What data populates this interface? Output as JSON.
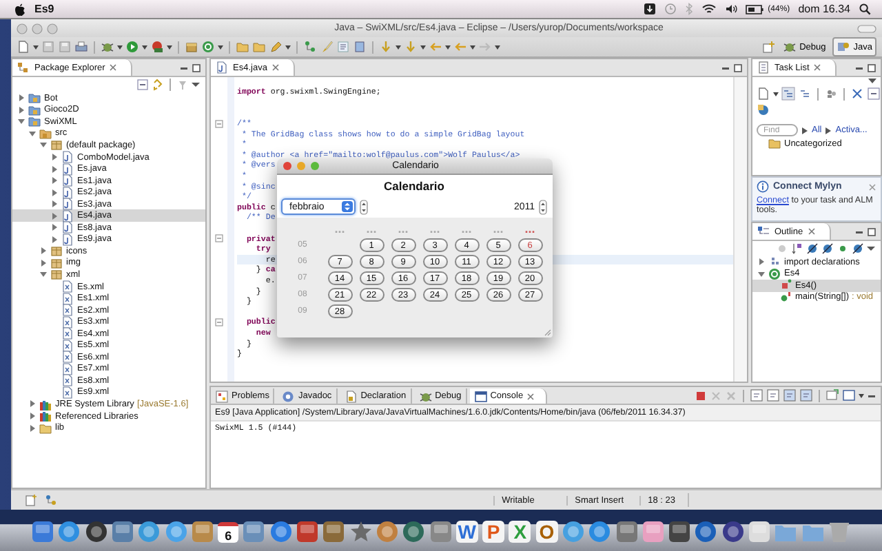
{
  "menubar": {
    "app": "Es9",
    "battery": "(44%)",
    "clock": "dom 16.34"
  },
  "window": {
    "title": "Java – SwiXML/src/Es4.java – Eclipse – /Users/yurop/Documents/workspace"
  },
  "perspectives": [
    {
      "label": "Debug",
      "selected": false
    },
    {
      "label": "Java",
      "selected": true
    }
  ],
  "package_explorer": {
    "title": "Package Explorer",
    "tree": [
      {
        "label": "Bot",
        "kind": "project",
        "expanded": false,
        "selected": false
      },
      {
        "label": "Gioco2D",
        "kind": "project",
        "expanded": false,
        "selected": false
      },
      {
        "label": "SwiXML",
        "kind": "project",
        "expanded": true,
        "selected": false,
        "children": [
          {
            "label": "src",
            "kind": "source",
            "expanded": true,
            "selected": false,
            "children": [
              {
                "label": "(default package)",
                "kind": "package",
                "expanded": true,
                "selected": false,
                "children": [
                  {
                    "label": "ComboModel.java",
                    "kind": "java",
                    "expanded": false,
                    "selected": false
                  },
                  {
                    "label": "Es.java",
                    "kind": "java",
                    "expanded": false,
                    "selected": false
                  },
                  {
                    "label": "Es1.java",
                    "kind": "java",
                    "expanded": false,
                    "selected": false
                  },
                  {
                    "label": "Es2.java",
                    "kind": "java",
                    "expanded": false,
                    "selected": false
                  },
                  {
                    "label": "Es3.java",
                    "kind": "java",
                    "expanded": false,
                    "selected": false
                  },
                  {
                    "label": "Es4.java",
                    "kind": "java",
                    "expanded": false,
                    "selected": true
                  },
                  {
                    "label": "Es8.java",
                    "kind": "java",
                    "expanded": false,
                    "selected": false
                  },
                  {
                    "label": "Es9.java",
                    "kind": "java",
                    "expanded": false,
                    "selected": false
                  }
                ]
              },
              {
                "label": "icons",
                "kind": "package",
                "expanded": false,
                "selected": false
              },
              {
                "label": "img",
                "kind": "package",
                "expanded": false,
                "selected": false
              },
              {
                "label": "xml",
                "kind": "package",
                "expanded": true,
                "selected": false,
                "children": [
                  {
                    "label": "Es.xml",
                    "kind": "xml",
                    "selected": false
                  },
                  {
                    "label": "Es1.xml",
                    "kind": "xml",
                    "selected": false
                  },
                  {
                    "label": "Es2.xml",
                    "kind": "xml",
                    "selected": false
                  },
                  {
                    "label": "Es3.xml",
                    "kind": "xml",
                    "selected": false
                  },
                  {
                    "label": "Es4.xml",
                    "kind": "xml",
                    "selected": false
                  },
                  {
                    "label": "Es5.xml",
                    "kind": "xml",
                    "selected": false
                  },
                  {
                    "label": "Es6.xml",
                    "kind": "xml",
                    "selected": false
                  },
                  {
                    "label": "Es7.xml",
                    "kind": "xml",
                    "selected": false
                  },
                  {
                    "label": "Es8.xml",
                    "kind": "xml",
                    "selected": false
                  },
                  {
                    "label": "Es9.xml",
                    "kind": "xml",
                    "selected": false
                  }
                ]
              }
            ]
          },
          {
            "label": "JRE System Library",
            "decoration": "[JavaSE-1.6]",
            "kind": "library",
            "expanded": false,
            "selected": false
          },
          {
            "label": "Referenced Libraries",
            "kind": "library",
            "expanded": false,
            "selected": false
          },
          {
            "label": "lib",
            "kind": "folder",
            "expanded": false,
            "selected": false
          }
        ]
      }
    ]
  },
  "editor": {
    "tab": "Es4.java",
    "lines": [
      {
        "segments": [
          {
            "text": "import",
            "kind": "keyword"
          },
          {
            "text": " org.swixml.SwingEngine;",
            "kind": "plain"
          }
        ]
      },
      {
        "kind": "blank"
      },
      {
        "kind": "blank"
      },
      {
        "fold": true,
        "segments": [
          {
            "text": "/**",
            "kind": "comment"
          }
        ]
      },
      {
        "segments": [
          {
            "text": " * The GridBag class shows how to do a simple GridBag layout",
            "kind": "comment"
          }
        ]
      },
      {
        "segments": [
          {
            "text": " *",
            "kind": "comment"
          }
        ]
      },
      {
        "segments": [
          {
            "text": " * @author <a href=\"mailto:wolf@paulus.com\">Wolf Paulus</a>",
            "kind": "comment"
          }
        ]
      },
      {
        "segments": [
          {
            "text": " * @vers",
            "kind": "comment"
          }
        ]
      },
      {
        "segments": [
          {
            "text": " *",
            "kind": "comment"
          }
        ]
      },
      {
        "segments": [
          {
            "text": " * @sinc",
            "kind": "comment"
          }
        ]
      },
      {
        "segments": [
          {
            "text": " */",
            "kind": "comment"
          }
        ]
      },
      {
        "segments": [
          {
            "text": "public",
            "kind": "keyword"
          },
          {
            "text": " c",
            "kind": "plain"
          }
        ]
      },
      {
        "segments": [
          {
            "text": "  /** De",
            "kind": "comment"
          }
        ]
      },
      {
        "kind": "blank"
      },
      {
        "fold": true,
        "segments": [
          {
            "text": "  privat",
            "kind": "keyword"
          }
        ]
      },
      {
        "segments": [
          {
            "text": "    try",
            "kind": "keyword"
          }
        ]
      },
      {
        "highlighted": true,
        "segments": [
          {
            "text": "      re",
            "kind": "plain"
          }
        ]
      },
      {
        "segments": [
          {
            "text": "    } ",
            "kind": "plain"
          },
          {
            "text": "ca",
            "kind": "keyword"
          }
        ]
      },
      {
        "segments": [
          {
            "text": "      e.",
            "kind": "plain"
          }
        ]
      },
      {
        "segments": [
          {
            "text": "    }",
            "kind": "plain"
          }
        ]
      },
      {
        "segments": [
          {
            "text": "  }",
            "kind": "plain"
          }
        ]
      },
      {
        "kind": "blank"
      },
      {
        "fold": true,
        "segments": [
          {
            "text": "  public",
            "kind": "keyword"
          }
        ]
      },
      {
        "segments": [
          {
            "text": "    new",
            "kind": "keyword"
          }
        ]
      },
      {
        "segments": [
          {
            "text": "  }",
            "kind": "plain"
          }
        ]
      },
      {
        "segments": [
          {
            "text": "}",
            "kind": "plain"
          }
        ]
      }
    ]
  },
  "dialog": {
    "title": "Calendario",
    "heading": "Calendario",
    "month": "febbraio",
    "year": "2011",
    "weekdays": [
      {
        "text": "...",
        "color": "#a8a8a8"
      },
      {
        "text": "...",
        "color": "#a8a8a8"
      },
      {
        "text": "...",
        "color": "#a8a8a8"
      },
      {
        "text": "...",
        "color": "#a8a8a8"
      },
      {
        "text": "...",
        "color": "#a8a8a8"
      },
      {
        "text": "...",
        "color": "#a8a8a8"
      },
      {
        "text": "...",
        "color": "#d05a5a"
      }
    ],
    "weeks": [
      {
        "number": "05",
        "days": [
          {
            "label": "1",
            "today": false
          },
          {
            "label": "2",
            "today": false
          },
          {
            "label": "3",
            "today": false
          },
          {
            "label": "4",
            "today": false
          },
          {
            "label": "5",
            "today": false
          },
          {
            "label": "6",
            "today": true
          }
        ]
      },
      {
        "number": "06",
        "days": [
          {
            "label": "7",
            "today": false
          },
          {
            "label": "8",
            "today": false
          },
          {
            "label": "9",
            "today": false
          },
          {
            "label": "10",
            "today": false
          },
          {
            "label": "11",
            "today": false
          },
          {
            "label": "12",
            "today": false
          },
          {
            "label": "13",
            "today": false
          }
        ]
      },
      {
        "number": "07",
        "days": [
          {
            "label": "14",
            "today": false
          },
          {
            "label": "15",
            "today": false
          },
          {
            "label": "16",
            "today": false
          },
          {
            "label": "17",
            "today": false
          },
          {
            "label": "18",
            "today": false
          },
          {
            "label": "19",
            "today": false
          },
          {
            "label": "20",
            "today": false
          }
        ]
      },
      {
        "number": "08",
        "days": [
          {
            "label": "21",
            "today": false
          },
          {
            "label": "22",
            "today": false
          },
          {
            "label": "23",
            "today": false
          },
          {
            "label": "24",
            "today": false
          },
          {
            "label": "25",
            "today": false
          },
          {
            "label": "26",
            "today": false
          },
          {
            "label": "27",
            "today": false
          }
        ]
      },
      {
        "number": "09",
        "days": [
          {
            "label": "28",
            "today": false
          }
        ]
      }
    ]
  },
  "task_list": {
    "title": "Task List",
    "find_placeholder": "Find",
    "filters": [
      "All",
      "Activa..."
    ],
    "category": "Uncategorized"
  },
  "mylyn": {
    "title": "Connect Mylyn",
    "link": "Connect",
    "message": " to your task and ALM tools."
  },
  "outline": {
    "title": "Outline",
    "tree": [
      {
        "label": "import declarations",
        "kind": "imports",
        "expanded": false,
        "selected": false
      },
      {
        "label": "Es4",
        "kind": "class",
        "expanded": true,
        "selected": false,
        "children": [
          {
            "label": "Es4()",
            "kind": "constructor",
            "selected": true
          },
          {
            "label": "main(String[])",
            "decoration": ": void",
            "kind": "method",
            "selected": false
          }
        ]
      }
    ]
  },
  "console": {
    "tabs": [
      {
        "label": "Problems",
        "selected": false
      },
      {
        "label": "Javadoc",
        "selected": false
      },
      {
        "label": "Declaration",
        "selected": false
      },
      {
        "label": "Debug",
        "selected": false
      },
      {
        "label": "Console",
        "selected": true
      }
    ],
    "header": "Es9 [Java Application] /System/Library/Java/JavaVirtualMachines/1.6.0.jdk/Contents/Home/bin/java (06/feb/2011 16.34.37)",
    "output": "SwixML 1.5 (#144)"
  },
  "status_bar": {
    "fields": [
      "Writable",
      "Smart Insert",
      "18 : 23"
    ]
  },
  "dock": {
    "items": [
      {
        "kind": "square",
        "color": "#3b7ad8"
      },
      {
        "kind": "round",
        "color": "#2f8fe0"
      },
      {
        "kind": "round",
        "color": "#333333"
      },
      {
        "kind": "square",
        "color": "#5a7fa8"
      },
      {
        "kind": "round",
        "color": "#3a9ad9"
      },
      {
        "kind": "round",
        "color": "#4aa3e8"
      },
      {
        "kind": "square",
        "color": "#b88a4a"
      },
      {
        "kind": "calendar",
        "text": "6",
        "color": "#ffffff"
      },
      {
        "kind": "square",
        "color": "#6a8fb8"
      },
      {
        "kind": "round",
        "color": "#2a7be0"
      },
      {
        "kind": "square",
        "color": "#c0392b"
      },
      {
        "kind": "square",
        "color": "#8a6a3a"
      },
      {
        "kind": "star",
        "color": "#6a6a6a"
      },
      {
        "kind": "round",
        "color": "#c08040"
      },
      {
        "kind": "round",
        "color": "#2d6a5a"
      },
      {
        "kind": "square",
        "color": "#888888"
      },
      {
        "kind": "letter",
        "text": "W",
        "color": "#2e6fd6"
      },
      {
        "kind": "letter",
        "text": "P",
        "color": "#e0581a"
      },
      {
        "kind": "letter",
        "text": "X",
        "color": "#2e9e3e"
      },
      {
        "kind": "letter",
        "text": "O",
        "color": "#a86000"
      },
      {
        "kind": "round",
        "color": "#46a0e0"
      },
      {
        "kind": "round",
        "color": "#2a8be0"
      },
      {
        "kind": "square",
        "color": "#777777"
      },
      {
        "kind": "square",
        "color": "#e8a0c0"
      },
      {
        "kind": "square",
        "color": "#444444"
      },
      {
        "kind": "round",
        "color": "#1a5fb8"
      },
      {
        "kind": "round",
        "color": "#3a3a8a"
      },
      {
        "kind": "square",
        "color": "#dddddd"
      },
      {
        "kind": "folder",
        "color": "#7aa8d8"
      },
      {
        "kind": "folder",
        "color": "#7aa8d8"
      },
      {
        "kind": "trash",
        "color": "#aaaaaa"
      }
    ]
  }
}
